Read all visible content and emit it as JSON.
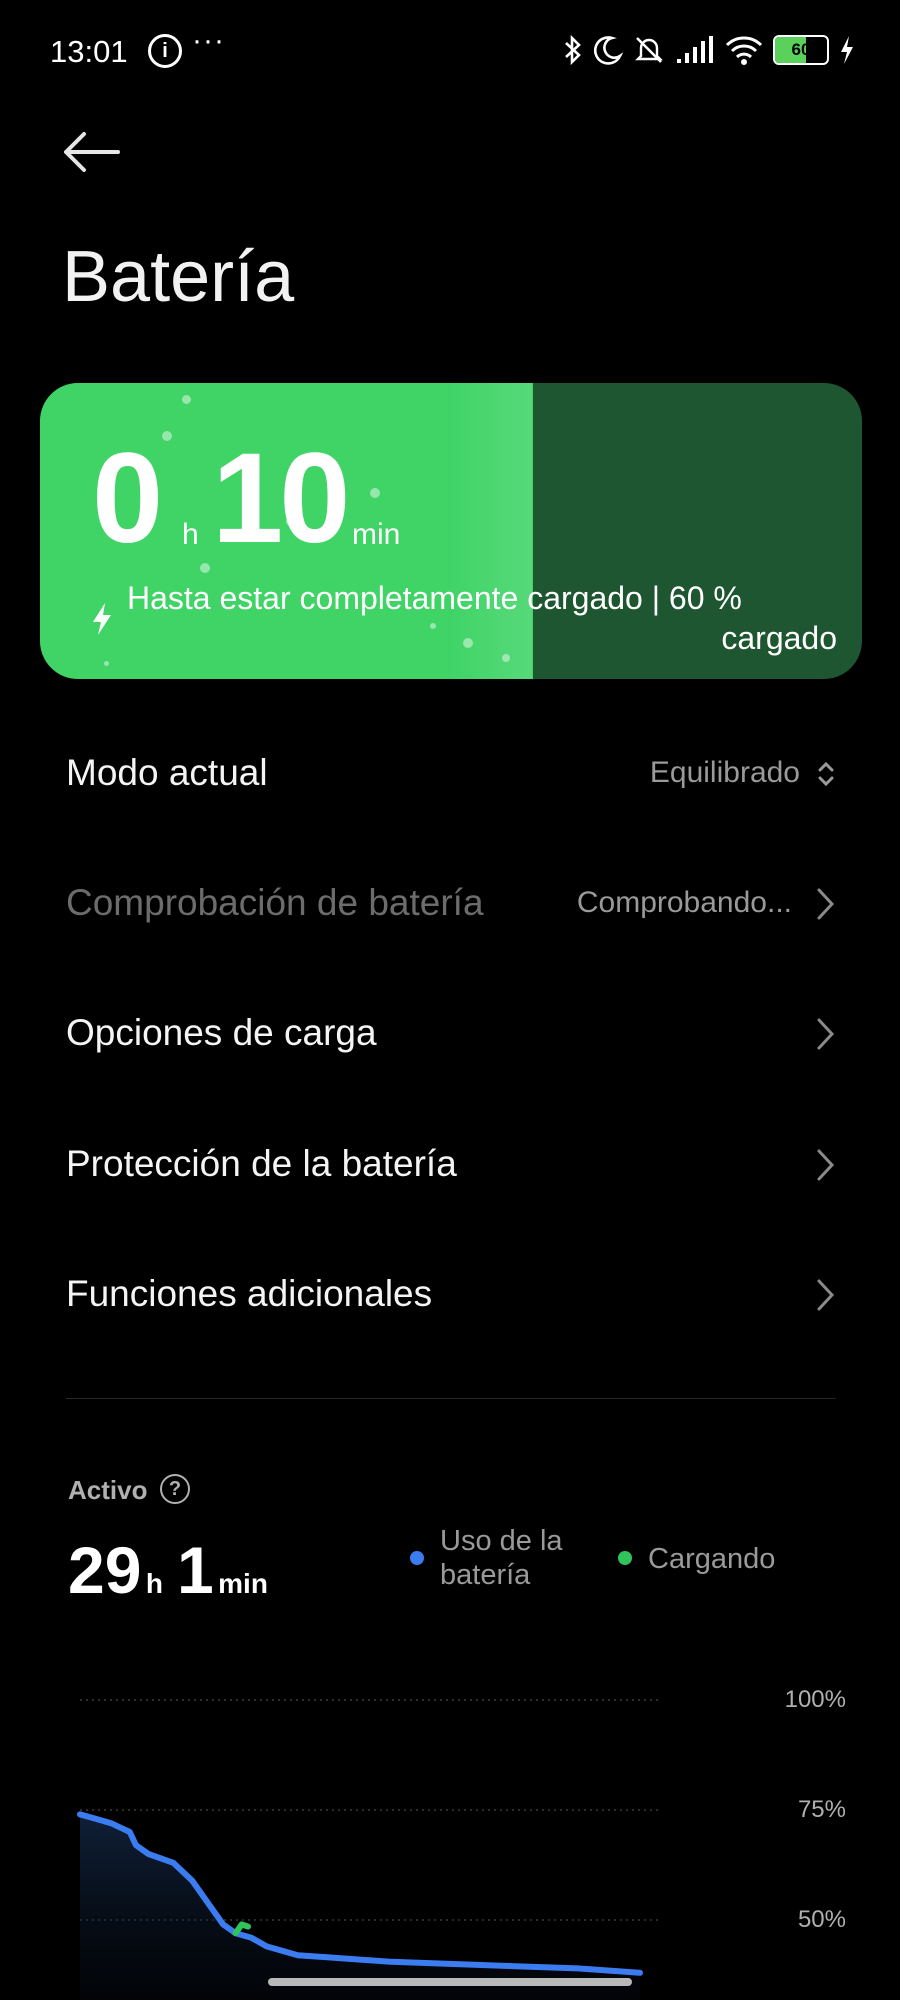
{
  "status_bar": {
    "time": "13:01",
    "info_symbol": "i",
    "more_symbol": "···",
    "battery_level": "60"
  },
  "header": {
    "title": "Batería"
  },
  "charge_card": {
    "hours": "0",
    "hours_unit": "h",
    "minutes": "10",
    "minutes_unit": "min",
    "description_line1": "Hasta estar completamente cargado | 60 %",
    "description_line2": "cargado",
    "fill_fraction": 0.6,
    "fill_color": "#40d467",
    "track_color": "#1d5630"
  },
  "settings": {
    "mode": {
      "label": "Modo actual",
      "value": "Equilibrado"
    },
    "check": {
      "label": "Comprobación de batería",
      "value": "Comprobando..."
    },
    "charging_options": {
      "label": "Opciones de carga"
    },
    "protection": {
      "label": "Protección de la batería"
    },
    "extra": {
      "label": "Funciones adicionales"
    }
  },
  "activity": {
    "label": "Activo",
    "hours": "29",
    "hours_unit": "h",
    "minutes": "1",
    "minutes_unit": "min",
    "legend_usage_line1": "Uso de la",
    "legend_usage_line2": "batería",
    "legend_charging": "Cargando",
    "usage_color": "#3b7df0",
    "charging_color": "#2ec45a"
  },
  "chart_data": {
    "type": "line",
    "ytick_labels": [
      "100%",
      "75%",
      "50%"
    ],
    "ylim": [
      0,
      100
    ],
    "series": [
      {
        "name": "Uso de la batería",
        "color": "#3b7df0",
        "points": [
          [
            0,
            74
          ],
          [
            5,
            73
          ],
          [
            10,
            72
          ],
          [
            16,
            70
          ],
          [
            18,
            67
          ],
          [
            22,
            65
          ],
          [
            30,
            63
          ],
          [
            36,
            59
          ],
          [
            46,
            49
          ],
          [
            50,
            47
          ],
          [
            55,
            46
          ],
          [
            60,
            44
          ],
          [
            70,
            42
          ],
          [
            80,
            41.5
          ],
          [
            90,
            41
          ],
          [
            100,
            40.5
          ],
          [
            120,
            40
          ],
          [
            140,
            39.5
          ],
          [
            160,
            39
          ],
          [
            180,
            38
          ]
        ]
      },
      {
        "name": "Cargando",
        "color": "#2ec45a",
        "points": [
          [
            50,
            47
          ],
          [
            52,
            49
          ],
          [
            54,
            48.5
          ]
        ]
      }
    ]
  }
}
